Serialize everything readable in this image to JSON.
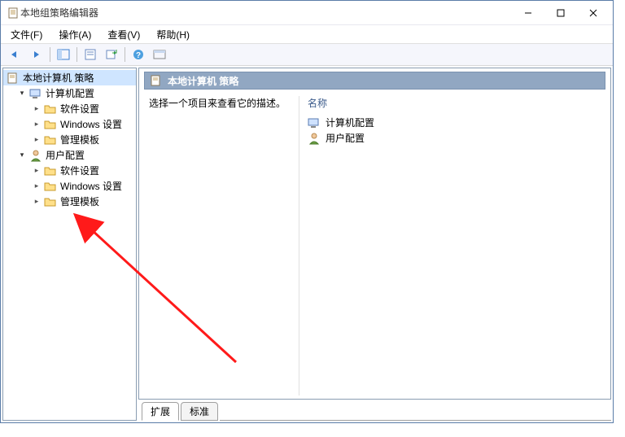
{
  "titlebar": {
    "title": "本地组策略编辑器"
  },
  "menu": {
    "file": "文件(F)",
    "action": "操作(A)",
    "view": "查看(V)",
    "help": "帮助(H)"
  },
  "tree": {
    "root": "本地计算机 策略",
    "computer": {
      "label": "计算机配置",
      "children": {
        "software": "软件设置",
        "windows": "Windows 设置",
        "admin": "管理模板"
      }
    },
    "user": {
      "label": "用户配置",
      "children": {
        "software": "软件设置",
        "windows": "Windows 设置",
        "admin": "管理模板"
      }
    }
  },
  "content": {
    "header": "本地计算机 策略",
    "description_prompt": "选择一个项目来查看它的描述。",
    "name_col": "名称",
    "items": {
      "computer": "计算机配置",
      "user": "用户配置"
    }
  },
  "tabs": {
    "extended": "扩展",
    "standard": "标准"
  }
}
